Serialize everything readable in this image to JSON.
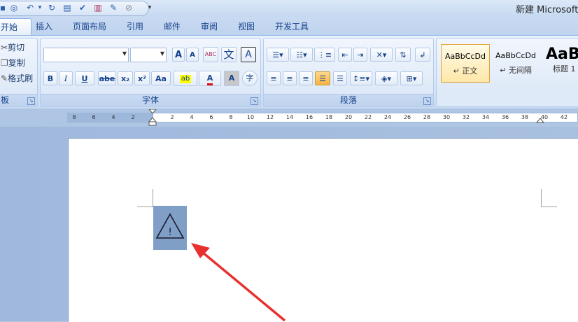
{
  "app": {
    "title": "新建 Microsoft"
  },
  "quick_access": [
    {
      "name": "save-icon",
      "glyph": "▪"
    },
    {
      "name": "print-preview-icon",
      "glyph": "◎"
    },
    {
      "name": "undo-icon",
      "glyph": "↶"
    },
    {
      "name": "undo-dropdown-icon",
      "glyph": "▾"
    },
    {
      "name": "redo-icon",
      "glyph": "↻"
    },
    {
      "name": "preview-icon",
      "glyph": "▤"
    },
    {
      "name": "spelling-icon",
      "glyph": "✔"
    },
    {
      "name": "document-icon",
      "glyph": "▥"
    },
    {
      "name": "picture-icon",
      "glyph": "✎"
    },
    {
      "name": "brush-icon",
      "glyph": "⊘"
    },
    {
      "name": "customize-icon",
      "glyph": "▾"
    }
  ],
  "tabs": [
    "开始",
    "插入",
    "页面布局",
    "引用",
    "邮件",
    "审阅",
    "视图",
    "开发工具"
  ],
  "clipboard": {
    "cut": "剪切",
    "copy": "复制",
    "format_painter": "格式刷",
    "group_label": "板"
  },
  "font": {
    "group_label": "字体",
    "grow": "A",
    "shrink": "A",
    "clear": "ABC",
    "phonetic": "文",
    "border_char": "A",
    "bold": "B",
    "italic": "I",
    "underline": "U",
    "strike": "abe",
    "subscript": "x₂",
    "superscript": "x²",
    "case": "Aa",
    "highlight": "ab",
    "font_color": "A",
    "shading": "A",
    "enclose": "字"
  },
  "paragraph": {
    "group_label": "段落"
  },
  "styles": [
    {
      "sample": "AaBbCcDd",
      "name": "↵ 正文"
    },
    {
      "sample": "AaBbCcDd",
      "name": "↵ 无间隔"
    },
    {
      "sample": "AaB",
      "name": "标题 1"
    }
  ],
  "ruler": {
    "left_ticks": [
      "8",
      "6",
      "4",
      "2"
    ],
    "right_ticks": [
      "2",
      "4",
      "6",
      "8",
      "10",
      "12",
      "14",
      "16",
      "18",
      "20",
      "22",
      "24",
      "26",
      "28",
      "30",
      "32",
      "34",
      "36",
      "38",
      "40",
      "42"
    ]
  },
  "document": {
    "warning_glyph": "!"
  },
  "colors": {
    "highlight": "#ffff00",
    "font_color": "#e01010",
    "arrow": "#e8312f",
    "selection": "#7f9fc6"
  }
}
